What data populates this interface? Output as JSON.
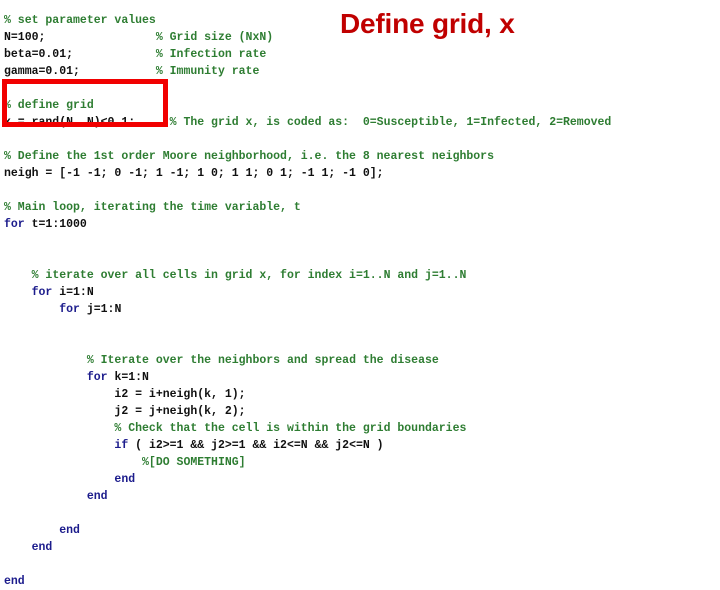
{
  "slide": {
    "title": "Define grid, x",
    "title_color": "#c00000",
    "highlight_color": "#f10000",
    "comment_color": "#2e7d32",
    "keyword_color": "#1c1c8c",
    "code_color": "#101010",
    "background": "#ffffff"
  },
  "code": {
    "language": "matlab",
    "lines": [
      {
        "indent": 0,
        "segments": [
          {
            "style": "cmt",
            "text": "% set parameter values"
          }
        ]
      },
      {
        "indent": 0,
        "segments": [
          {
            "style": "txt",
            "text": "N=100;"
          },
          {
            "style": "txt",
            "text": "                "
          },
          {
            "style": "cmt",
            "text": "% Grid size (NxN)"
          }
        ]
      },
      {
        "indent": 0,
        "segments": [
          {
            "style": "txt",
            "text": "beta=0.01;"
          },
          {
            "style": "txt",
            "text": "            "
          },
          {
            "style": "cmt",
            "text": "% Infection rate"
          }
        ]
      },
      {
        "indent": 0,
        "segments": [
          {
            "style": "txt",
            "text": "gamma=0.01;"
          },
          {
            "style": "txt",
            "text": "           "
          },
          {
            "style": "cmt",
            "text": "% Immunity rate"
          }
        ]
      },
      {
        "indent": 0,
        "segments": []
      },
      {
        "indent": 0,
        "segments": [
          {
            "style": "cmt",
            "text": "% define grid"
          }
        ]
      },
      {
        "indent": 0,
        "segments": [
          {
            "style": "txt",
            "text": "x = rand(N, N)<0.1;"
          },
          {
            "style": "txt",
            "text": "     "
          },
          {
            "style": "cmt",
            "text": "% The grid x, is coded as:  0=Susceptible, 1=Infected, 2=Removed"
          }
        ]
      },
      {
        "indent": 0,
        "segments": []
      },
      {
        "indent": 0,
        "segments": [
          {
            "style": "cmt",
            "text": "% Define the 1st order Moore neighborhood, i.e. the 8 nearest neighbors"
          }
        ]
      },
      {
        "indent": 0,
        "segments": [
          {
            "style": "txt",
            "text": "neigh = [-1 -1; 0 -1; 1 -1; 1 0; 1 1; 0 1; -1 1; -1 0];"
          }
        ]
      },
      {
        "indent": 0,
        "segments": []
      },
      {
        "indent": 0,
        "segments": [
          {
            "style": "cmt",
            "text": "% Main loop, iterating the time variable, t"
          }
        ]
      },
      {
        "indent": 0,
        "segments": [
          {
            "style": "kw",
            "text": "for"
          },
          {
            "style": "txt",
            "text": " t=1:1000"
          }
        ]
      },
      {
        "indent": 0,
        "segments": []
      },
      {
        "indent": 0,
        "segments": []
      },
      {
        "indent": 1,
        "segments": [
          {
            "style": "cmt",
            "text": "% iterate over all cells in grid x, for index i=1..N and j=1..N"
          }
        ]
      },
      {
        "indent": 1,
        "segments": [
          {
            "style": "kw",
            "text": "for"
          },
          {
            "style": "txt",
            "text": " i=1:N"
          }
        ]
      },
      {
        "indent": 2,
        "segments": [
          {
            "style": "kw",
            "text": "for"
          },
          {
            "style": "txt",
            "text": " j=1:N"
          }
        ]
      },
      {
        "indent": 0,
        "segments": []
      },
      {
        "indent": 0,
        "segments": []
      },
      {
        "indent": 3,
        "segments": [
          {
            "style": "cmt",
            "text": "% Iterate over the neighbors and spread the disease"
          }
        ]
      },
      {
        "indent": 3,
        "segments": [
          {
            "style": "kw",
            "text": "for"
          },
          {
            "style": "txt",
            "text": " k=1:N"
          }
        ]
      },
      {
        "indent": 4,
        "segments": [
          {
            "style": "txt",
            "text": "i2 = i+neigh(k, 1);"
          }
        ]
      },
      {
        "indent": 4,
        "segments": [
          {
            "style": "txt",
            "text": "j2 = j+neigh(k, 2);"
          }
        ]
      },
      {
        "indent": 4,
        "segments": [
          {
            "style": "cmt",
            "text": "% Check that the cell is within the grid boundaries"
          }
        ]
      },
      {
        "indent": 4,
        "segments": [
          {
            "style": "kw",
            "text": "if"
          },
          {
            "style": "txt",
            "text": " ( i2>=1 && j2>=1 && i2<=N && j2<=N )"
          }
        ]
      },
      {
        "indent": 5,
        "segments": [
          {
            "style": "cmt",
            "text": "%[DO SOMETHING]"
          }
        ]
      },
      {
        "indent": 4,
        "segments": [
          {
            "style": "kw",
            "text": "end"
          }
        ]
      },
      {
        "indent": 3,
        "segments": [
          {
            "style": "kw",
            "text": "end"
          }
        ]
      },
      {
        "indent": 0,
        "segments": []
      },
      {
        "indent": 2,
        "segments": [
          {
            "style": "kw",
            "text": "end"
          }
        ]
      },
      {
        "indent": 1,
        "segments": [
          {
            "style": "kw",
            "text": "end"
          }
        ]
      },
      {
        "indent": 0,
        "segments": []
      },
      {
        "indent": 0,
        "segments": [
          {
            "style": "kw",
            "text": "end"
          }
        ]
      }
    ]
  }
}
